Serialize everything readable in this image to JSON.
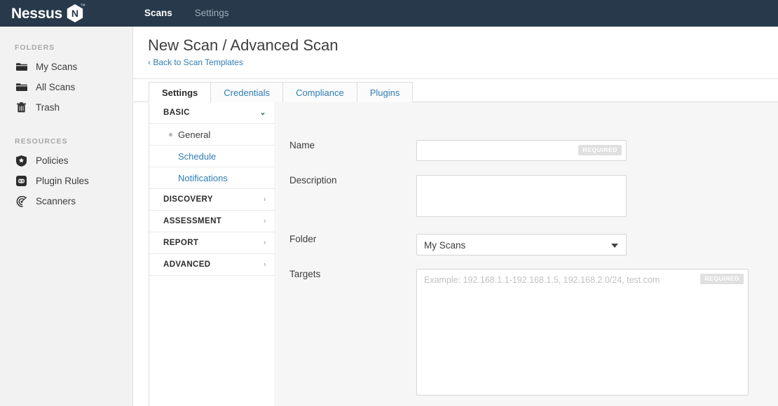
{
  "brand": {
    "name": "Nessus",
    "hex_letter": "N",
    "tm": "™"
  },
  "topnav": {
    "items": [
      {
        "label": "Scans",
        "active": true
      },
      {
        "label": "Settings",
        "active": false
      }
    ]
  },
  "sidebar": {
    "sections": [
      {
        "heading": "FOLDERS",
        "items": [
          {
            "label": "My Scans",
            "icon": "folder-icon"
          },
          {
            "label": "All Scans",
            "icon": "folder-icon"
          },
          {
            "label": "Trash",
            "icon": "trash-icon"
          }
        ]
      },
      {
        "heading": "RESOURCES",
        "items": [
          {
            "label": "Policies",
            "icon": "shield-icon"
          },
          {
            "label": "Plugin Rules",
            "icon": "plugin-icon"
          },
          {
            "label": "Scanners",
            "icon": "radar-icon"
          }
        ]
      }
    ]
  },
  "page": {
    "title": "New Scan / Advanced Scan",
    "back_link": "‹ Back to Scan Templates"
  },
  "tabs": [
    {
      "label": "Settings",
      "active": true
    },
    {
      "label": "Credentials",
      "active": false
    },
    {
      "label": "Compliance",
      "active": false
    },
    {
      "label": "Plugins",
      "active": false
    }
  ],
  "settings_nav": [
    {
      "label": "BASIC",
      "type": "group",
      "caret": "⌄",
      "expanded": true
    },
    {
      "label": "General",
      "type": "sub",
      "current": true
    },
    {
      "label": "Schedule",
      "type": "sub",
      "current": false
    },
    {
      "label": "Notifications",
      "type": "sub",
      "current": false
    },
    {
      "label": "DISCOVERY",
      "type": "group",
      "caret": "›",
      "expanded": false
    },
    {
      "label": "ASSESSMENT",
      "type": "group",
      "caret": "›",
      "expanded": false
    },
    {
      "label": "REPORT",
      "type": "group",
      "caret": "›",
      "expanded": false
    },
    {
      "label": "ADVANCED",
      "type": "group",
      "caret": "›",
      "expanded": false
    }
  ],
  "form": {
    "name": {
      "label": "Name",
      "value": "",
      "placeholder": "",
      "badge": "REQUIRED"
    },
    "description": {
      "label": "Description",
      "value": "",
      "placeholder": ""
    },
    "folder": {
      "label": "Folder",
      "value": "My Scans",
      "options": [
        "My Scans"
      ]
    },
    "targets": {
      "label": "Targets",
      "value": "",
      "placeholder": "Example: 192.168.1.1-192.168.1.5, 192.168.2.0/24, test.com",
      "badge": "REQUIRED"
    }
  },
  "colors": {
    "topnav_bg": "#27394b",
    "sidebar_bg": "#f2f2f2",
    "link": "#2e7db4",
    "form_bg": "#f6f6f6",
    "badge_bg": "#e0e0e0"
  }
}
